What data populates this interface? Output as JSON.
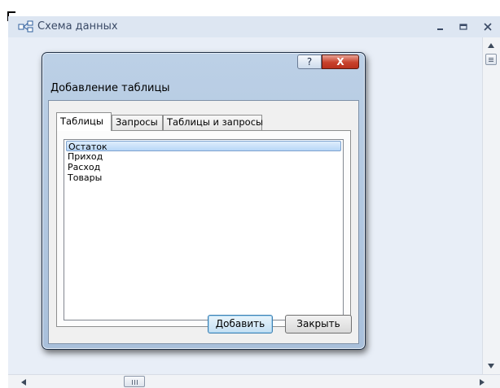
{
  "window": {
    "title": "Схема данных",
    "icon": "relationships-icon"
  },
  "dialog": {
    "title": "Добавление таблицы",
    "help_label": "?",
    "close_label": "X",
    "tabs": [
      {
        "label": "Таблицы",
        "active": true
      },
      {
        "label": "Запросы",
        "active": false
      },
      {
        "label": "Таблицы и запросы",
        "active": false
      }
    ],
    "items": [
      {
        "label": "Остаток",
        "selected": true
      },
      {
        "label": "Приход",
        "selected": false
      },
      {
        "label": "Расход",
        "selected": false
      },
      {
        "label": "Товары",
        "selected": false
      }
    ],
    "add_label": "Добавить",
    "close_button_label": "Закрыть"
  },
  "colors": {
    "accent": "#3c7fb1",
    "workspace": "#e8eef7",
    "close": "#c8412b"
  }
}
